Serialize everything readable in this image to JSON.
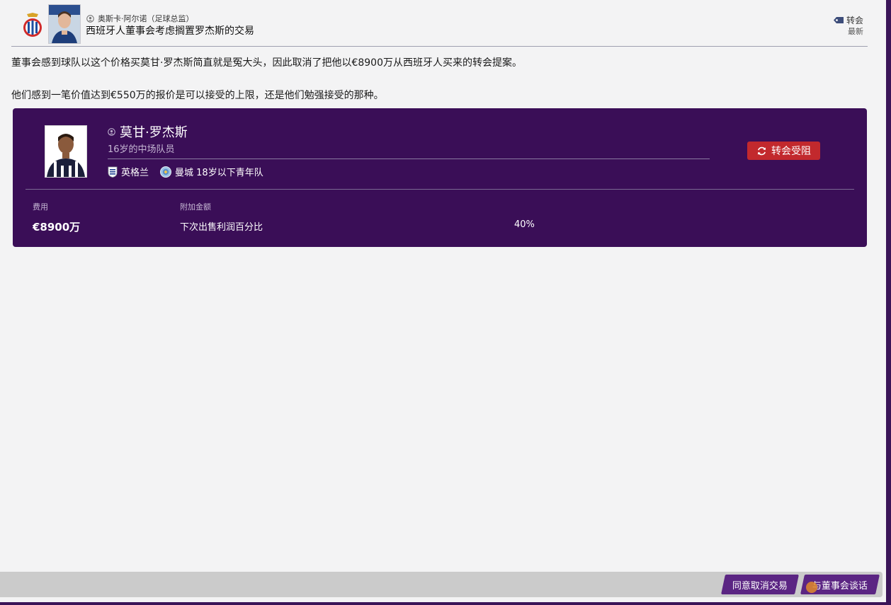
{
  "header": {
    "sender": "奥斯卡·阿尔诺（足球总监）",
    "headline": "西班牙人董事会考虑搁置罗杰斯的交易",
    "tag": "转会",
    "tag_sub": "最新"
  },
  "body": {
    "paragraph1": "董事会感到球队以这个价格买莫甘·罗杰斯简直就是冤大头，因此取消了把他以€8900万从西班牙人买来的转会提案。",
    "paragraph2": "他们感到一笔价值达到€550万的报价是可以接受的上限，还是他们勉强接受的那种。"
  },
  "player": {
    "name": "莫甘·罗杰斯",
    "description": "16岁的中场队员",
    "nation": "英格兰",
    "club": "曼城 18岁以下青年队",
    "status": "转会受阻"
  },
  "deal": {
    "fee_label": "费用",
    "fee_value": "€8900万",
    "bonus_label": "附加金额",
    "bonus_name": "下次出售利润百分比",
    "bonus_value": "40%"
  },
  "footer": {
    "cancel_label": "同意取消交易",
    "talk_label": "与董事会谈话"
  },
  "colors": {
    "card_bg": "#3a0e57",
    "status_red": "#c2292d",
    "footer_button": "#5b2583"
  },
  "icons": {
    "crest": "espanyol-crest-icon",
    "person": "person-icon",
    "tag": "tag-icon",
    "nation": "england-flag-icon",
    "club": "man-city-crest-icon",
    "status": "refresh-icon"
  }
}
